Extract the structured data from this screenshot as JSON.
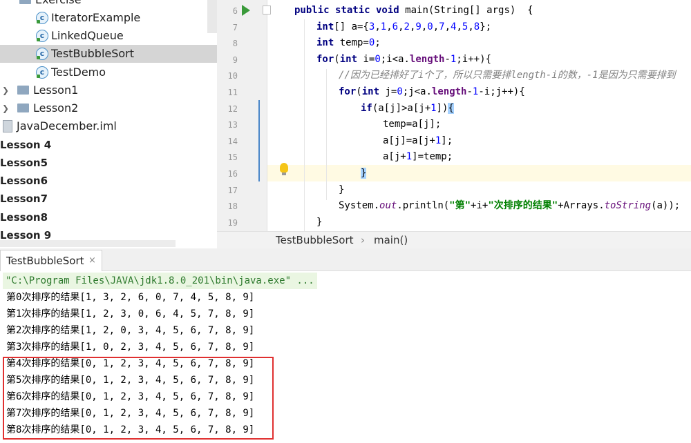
{
  "project_tree": {
    "items": [
      {
        "label": "Exercise"
      },
      {
        "label": "IteratorExample"
      },
      {
        "label": "LinkedQueue"
      },
      {
        "label": "TestBubbleSort"
      },
      {
        "label": "TestDemo"
      },
      {
        "label": "Lesson1"
      },
      {
        "label": "Lesson2"
      },
      {
        "label": "JavaDecember.iml"
      },
      {
        "label": "Lesson 4"
      },
      {
        "label": "Lesson5"
      },
      {
        "label": "Lesson6"
      },
      {
        "label": "Lesson7"
      },
      {
        "label": "Lesson8"
      },
      {
        "label": "Lesson 9"
      }
    ],
    "selected": "TestBubbleSort"
  },
  "editor": {
    "line_numbers": [
      "6",
      "7",
      "8",
      "9",
      "10",
      "11",
      "12",
      "13",
      "14",
      "15",
      "16",
      "17",
      "18",
      "19"
    ],
    "lines": [
      {
        "parts": [
          {
            "t": "public static void ",
            "c": "kw"
          },
          {
            "t": "main(String[] args)  {",
            "c": ""
          }
        ]
      },
      {
        "parts": [
          {
            "t": "int",
            "c": "kw"
          },
          {
            "t": "[] a={",
            "c": ""
          },
          {
            "t": "3",
            "c": "num"
          },
          {
            "t": ",",
            "c": ""
          },
          {
            "t": "1",
            "c": "num"
          },
          {
            "t": ",",
            "c": ""
          },
          {
            "t": "6",
            "c": "num"
          },
          {
            "t": ",",
            "c": ""
          },
          {
            "t": "2",
            "c": "num"
          },
          {
            "t": ",",
            "c": ""
          },
          {
            "t": "9",
            "c": "num"
          },
          {
            "t": ",",
            "c": ""
          },
          {
            "t": "0",
            "c": "num"
          },
          {
            "t": ",",
            "c": ""
          },
          {
            "t": "7",
            "c": "num"
          },
          {
            "t": ",",
            "c": ""
          },
          {
            "t": "4",
            "c": "num"
          },
          {
            "t": ",",
            "c": ""
          },
          {
            "t": "5",
            "c": "num"
          },
          {
            "t": ",",
            "c": ""
          },
          {
            "t": "8",
            "c": "num"
          },
          {
            "t": "};",
            "c": ""
          }
        ]
      },
      {
        "parts": [
          {
            "t": "int ",
            "c": "kw"
          },
          {
            "t": "temp=",
            "c": ""
          },
          {
            "t": "0",
            "c": "num"
          },
          {
            "t": ";",
            "c": ""
          }
        ]
      },
      {
        "parts": [
          {
            "t": "for",
            "c": "kw"
          },
          {
            "t": "(",
            "c": ""
          },
          {
            "t": "int ",
            "c": "kw"
          },
          {
            "t": "i=",
            "c": ""
          },
          {
            "t": "0",
            "c": "num"
          },
          {
            "t": ";i<a.",
            "c": ""
          },
          {
            "t": "length",
            "c": "field"
          },
          {
            "t": "-",
            "c": ""
          },
          {
            "t": "1",
            "c": "num"
          },
          {
            "t": ";i++){",
            "c": ""
          }
        ]
      },
      {
        "parts": [
          {
            "t": "//因为已经排好了i个了，所以只需要排length-i的数，-1是因为只需要排到",
            "c": "cmt"
          }
        ]
      },
      {
        "parts": [
          {
            "t": "for",
            "c": "kw"
          },
          {
            "t": "(",
            "c": ""
          },
          {
            "t": "int ",
            "c": "kw"
          },
          {
            "t": "j=",
            "c": ""
          },
          {
            "t": "0",
            "c": "num"
          },
          {
            "t": ";j<a.",
            "c": ""
          },
          {
            "t": "length",
            "c": "field"
          },
          {
            "t": "-",
            "c": ""
          },
          {
            "t": "1",
            "c": "num"
          },
          {
            "t": "-i;j++){",
            "c": ""
          }
        ]
      },
      {
        "parts": [
          {
            "t": "if",
            "c": "kw"
          },
          {
            "t": "(a[j]>a[j+",
            "c": ""
          },
          {
            "t": "1",
            "c": "num"
          },
          {
            "t": "])",
            "c": ""
          },
          {
            "t": "{",
            "c": "brk"
          }
        ]
      },
      {
        "parts": [
          {
            "t": "temp=a[j];",
            "c": ""
          }
        ]
      },
      {
        "parts": [
          {
            "t": "a[j]=a[j+",
            "c": ""
          },
          {
            "t": "1",
            "c": "num"
          },
          {
            "t": "];",
            "c": ""
          }
        ]
      },
      {
        "parts": [
          {
            "t": "a[j+",
            "c": ""
          },
          {
            "t": "1",
            "c": "num"
          },
          {
            "t": "]=temp;",
            "c": ""
          }
        ]
      },
      {
        "parts": [
          {
            "t": "}",
            "c": "brk"
          }
        ]
      },
      {
        "parts": [
          {
            "t": "}",
            "c": ""
          }
        ]
      },
      {
        "parts": [
          {
            "t": "System.",
            "c": ""
          },
          {
            "t": "out",
            "c": "static"
          },
          {
            "t": ".println(",
            "c": ""
          },
          {
            "t": "\"第\"",
            "c": "str"
          },
          {
            "t": "+i+",
            "c": ""
          },
          {
            "t": "\"次排序的结果\"",
            "c": "str"
          },
          {
            "t": "+Arrays.",
            "c": ""
          },
          {
            "t": "toString",
            "c": "static"
          },
          {
            "t": "(a));",
            "c": ""
          }
        ]
      },
      {
        "parts": [
          {
            "t": "}",
            "c": ""
          }
        ]
      }
    ]
  },
  "breadcrumb": {
    "class_name": "TestBubbleSort",
    "method_name": "main()"
  },
  "run": {
    "tab_label": "TestBubbleSort",
    "close_glyph": "×",
    "command": "\"C:\\Program Files\\JAVA\\jdk1.8.0_201\\bin\\java.exe\" ...",
    "output": [
      "第0次排序的结果[1, 3, 2, 6, 0, 7, 4, 5, 8, 9]",
      "第1次排序的结果[1, 2, 3, 0, 6, 4, 5, 7, 8, 9]",
      "第2次排序的结果[1, 2, 0, 3, 4, 5, 6, 7, 8, 9]",
      "第3次排序的结果[1, 0, 2, 3, 4, 5, 6, 7, 8, 9]",
      "第4次排序的结果[0, 1, 2, 3, 4, 5, 6, 7, 8, 9]",
      "第5次排序的结果[0, 1, 2, 3, 4, 5, 6, 7, 8, 9]",
      "第6次排序的结果[0, 1, 2, 3, 4, 5, 6, 7, 8, 9]",
      "第7次排序的结果[0, 1, 2, 3, 4, 5, 6, 7, 8, 9]",
      "第8次排序的结果[0, 1, 2, 3, 4, 5, 6, 7, 8, 9]"
    ]
  },
  "colors": {
    "highlight_box": "#e03030",
    "selection": "#d5d5d5",
    "current_line": "#fffae3"
  }
}
